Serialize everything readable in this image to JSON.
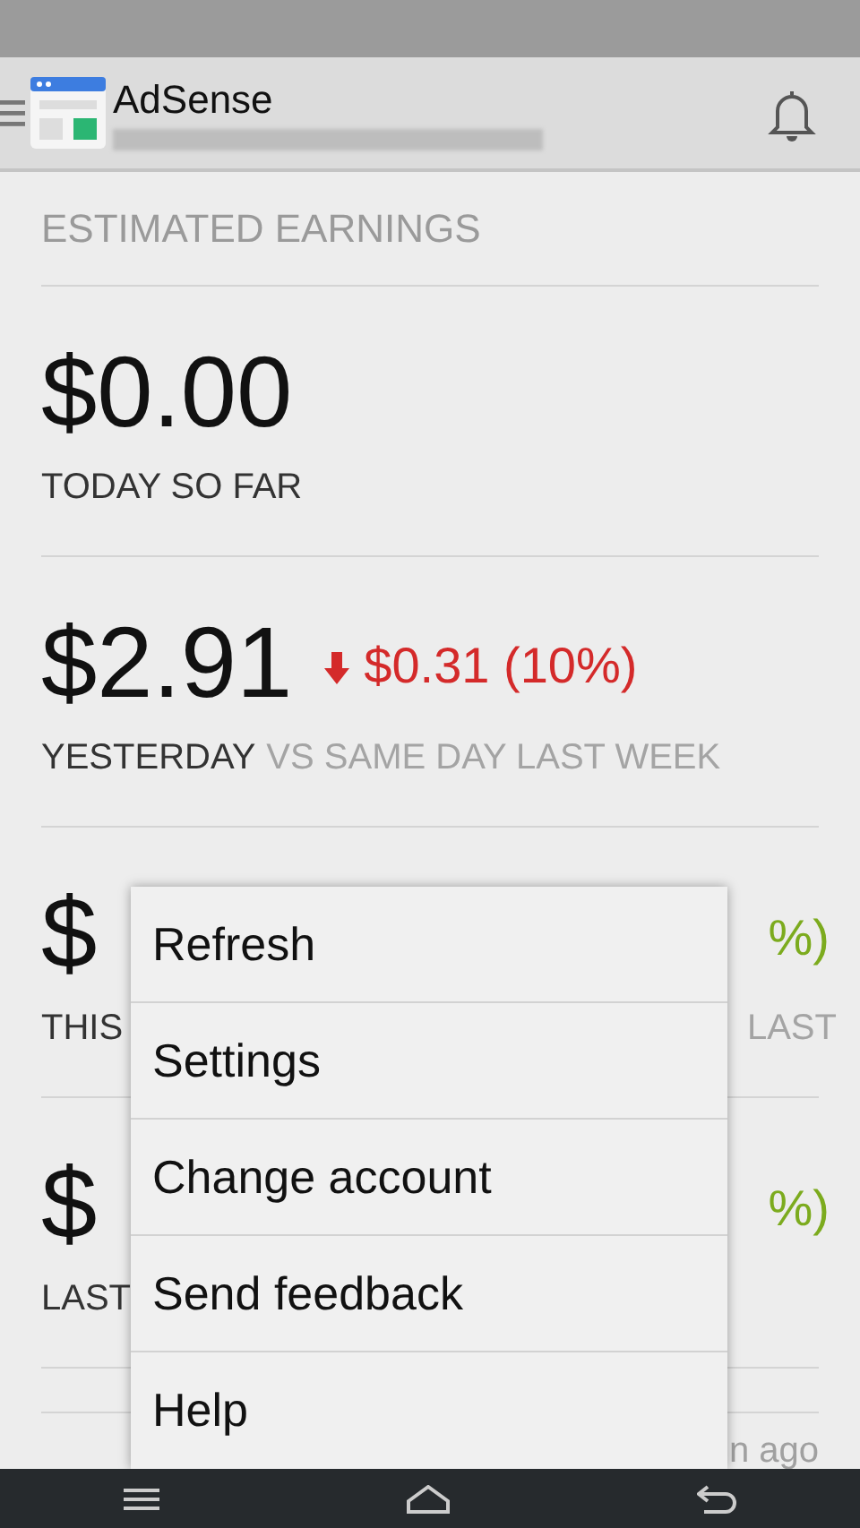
{
  "app_bar": {
    "title": "AdSense"
  },
  "section_title": "ESTIMATED EARNINGS",
  "rows": [
    {
      "kind": "plain",
      "amount": "$0.00",
      "label": "TODAY SO FAR"
    },
    {
      "kind": "down",
      "amount": "$2.91",
      "change": "$0.31 (10%)",
      "label": "YESTERDAY",
      "label_extra": "VS SAME DAY LAST WEEK"
    },
    {
      "kind": "up",
      "amount": "$",
      "change": "%)",
      "label": "THIS",
      "label_right": "LAST"
    },
    {
      "kind": "up",
      "amount": "$",
      "change": "%)",
      "label": "LAST"
    }
  ],
  "footer": "n ago",
  "menu": [
    {
      "label": "Refresh"
    },
    {
      "label": "Settings"
    },
    {
      "label": "Change account"
    },
    {
      "label": "Send feedback"
    },
    {
      "label": "Help"
    }
  ]
}
